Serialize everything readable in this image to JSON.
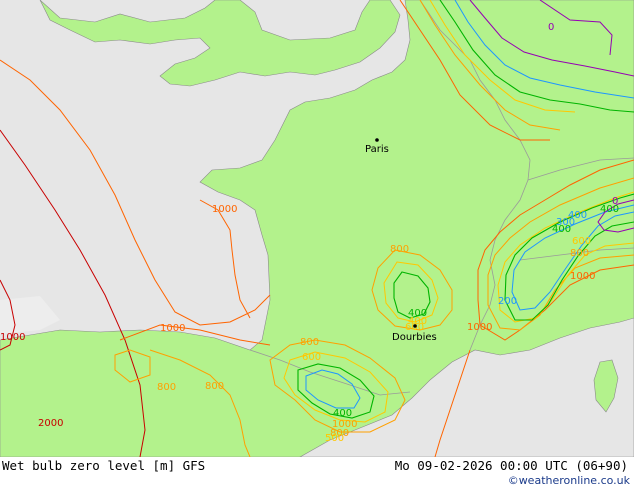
{
  "footer": {
    "title": "Wet bulb zero level [m] GFS",
    "datetime": "Mo 09-02-2026 00:00 UTC (06+90)",
    "credit": "©weatheronline.co.uk"
  },
  "cities": [
    {
      "name": "Paris"
    },
    {
      "name": "Dourbies"
    }
  ],
  "contour_labels": [
    "1000",
    "1000",
    "800",
    "800",
    "800",
    "800",
    "400",
    "400",
    "1000",
    "1000",
    "2000",
    "800",
    "600",
    "400",
    "200",
    "400",
    "0",
    "1000",
    "400",
    "600",
    "800",
    "1000",
    "300",
    "600",
    "500",
    "400",
    "0"
  ],
  "colors": {
    "land": "#b3f28c",
    "sea": "#e6e6e6",
    "outside_land": "#ededed",
    "c2000": "#c80000",
    "c1000": "#ff6400",
    "c800": "#ffa000",
    "c600": "#ffc800",
    "c400": "#00b400",
    "c200": "#1e96ff",
    "c0": "#9600b4"
  }
}
